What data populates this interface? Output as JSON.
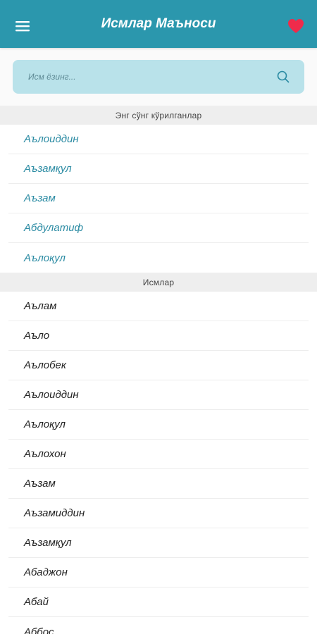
{
  "app": {
    "title": "Исмлар Маъноси",
    "accent_color": "#2b97ad",
    "heart_color": "#ef2b4b"
  },
  "search": {
    "placeholder": "Исм ёзинг...",
    "value": ""
  },
  "recent": {
    "header": "Энг сўнг кўрилганлар",
    "items": [
      "Аълоиддин",
      "Аъзамқул",
      "Аъзам",
      "Абдулатиф",
      "Аълоқул"
    ]
  },
  "names": {
    "header": "Исмлар",
    "items": [
      "Аълам",
      "Аъло",
      "Аълобек",
      "Аълоиддин",
      "Аълоқул",
      "Аълохон",
      "Аъзам",
      "Аъзамиддин",
      "Аъзамқул",
      "Абаджон",
      "Абай",
      "Аббос"
    ]
  },
  "icons": {
    "menu": "menu-icon",
    "favorite": "heart-icon",
    "search": "search-icon"
  }
}
